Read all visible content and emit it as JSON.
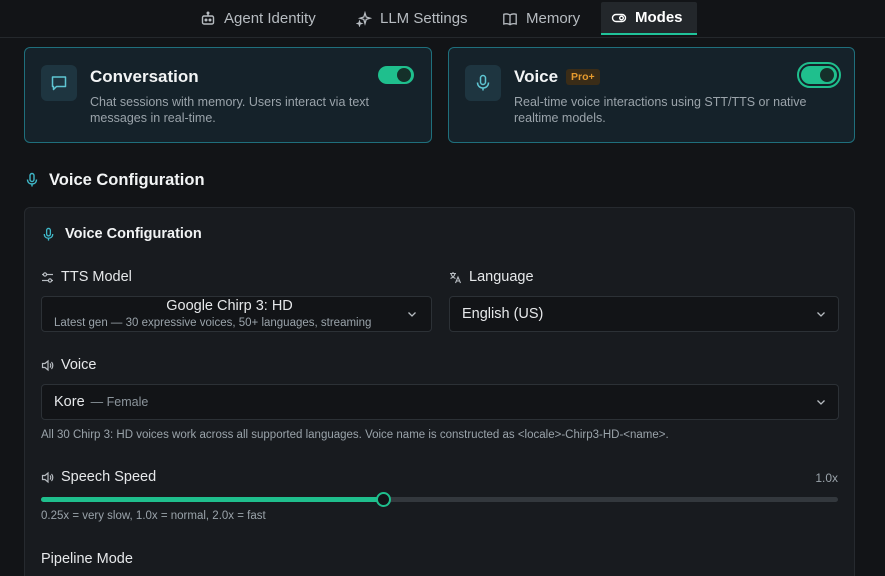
{
  "tabs": [
    {
      "label": "Agent Identity",
      "icon": "robot-icon"
    },
    {
      "label": "LLM Settings",
      "icon": "sparkles-icon"
    },
    {
      "label": "Memory",
      "icon": "book-icon"
    },
    {
      "label": "Modes",
      "icon": "toggle-icon",
      "active": true
    }
  ],
  "modes": {
    "conversation": {
      "title": "Conversation",
      "description": "Chat sessions with memory. Users interact via text messages in real-time.",
      "enabled": true
    },
    "voice": {
      "title": "Voice",
      "badge": "Pro+",
      "description": "Real-time voice interactions using STT/TTS or native realtime models.",
      "enabled": true
    }
  },
  "section": {
    "title": "Voice Configuration"
  },
  "panel": {
    "title": "Voice Configuration",
    "tts_model": {
      "label": "TTS Model",
      "value": "Google Chirp 3: HD",
      "subtitle": "Latest gen — 30 expressive voices, 50+ languages, streaming"
    },
    "language": {
      "label": "Language",
      "value": "English (US)"
    },
    "voice": {
      "label": "Voice",
      "value": "Kore",
      "subtitle": "— Female",
      "helper": "All 30 Chirp 3: HD voices work across all supported languages. Voice name is constructed as <locale>-Chirp3-HD-<name>."
    },
    "speech_speed": {
      "label": "Speech Speed",
      "value_text": "1.0x",
      "value": 1.0,
      "min": 0.25,
      "max": 2.0,
      "helper": "0.25x = very slow, 1.0x = normal, 2.0x = fast"
    },
    "pipeline_mode": {
      "label": "Pipeline Mode"
    }
  },
  "colors": {
    "accent": "#1fbf8d",
    "card_border": "#1f6f7c",
    "badge": "#e59a2e"
  }
}
